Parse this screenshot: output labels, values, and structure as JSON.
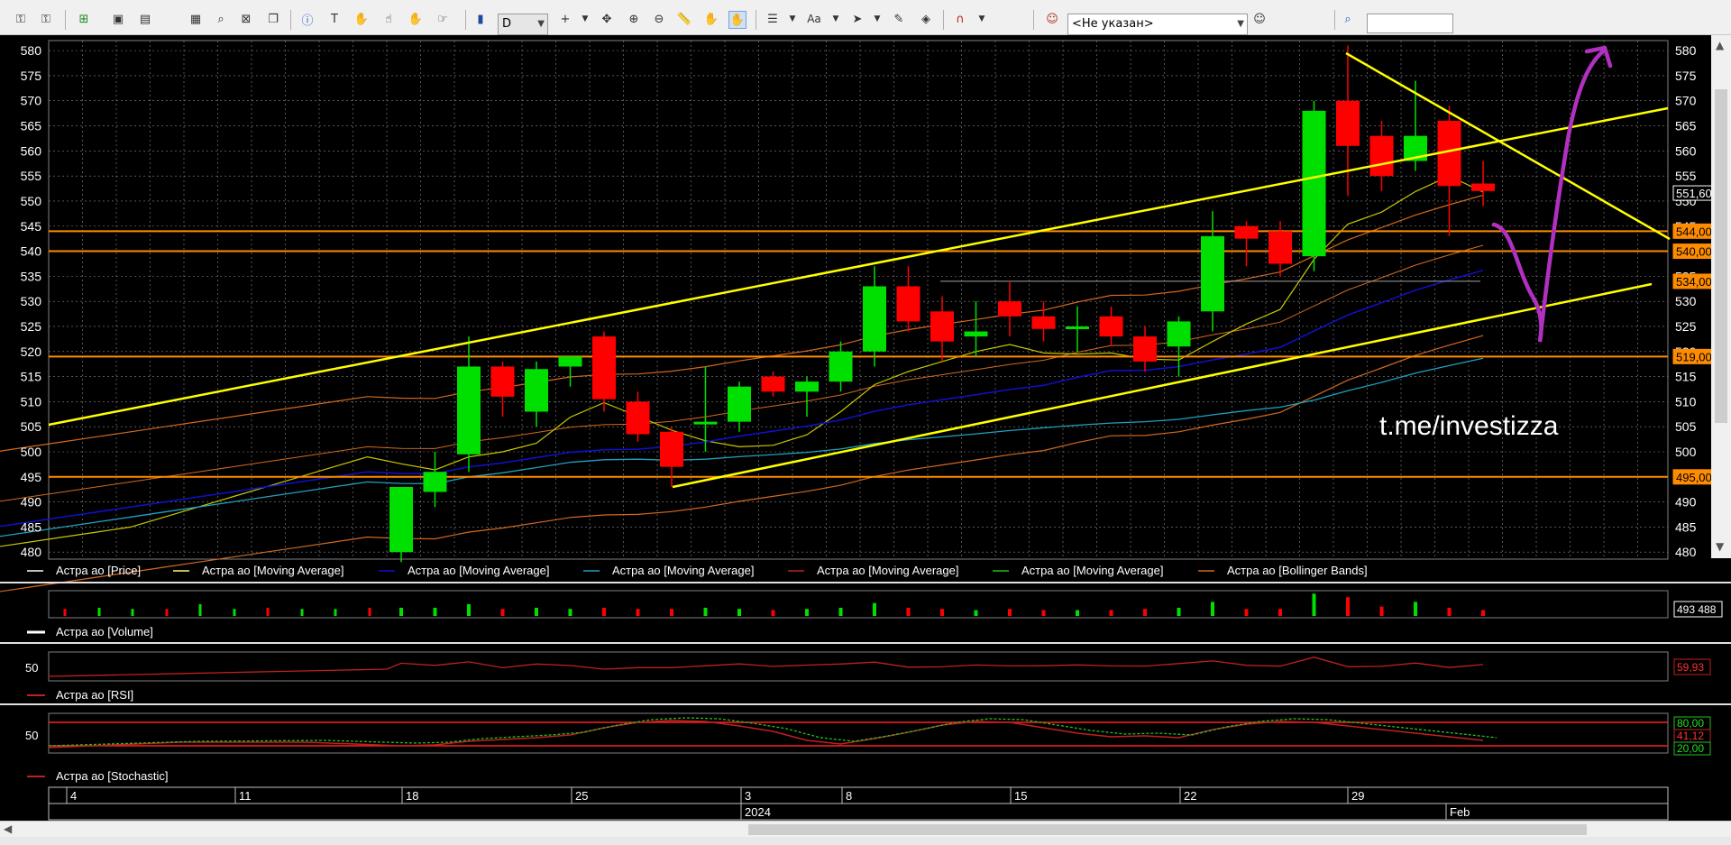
{
  "toolbar": {
    "timeframe": "D",
    "account_select": "<Не указан>",
    "search_value": ""
  },
  "instrument": "Астра ао",
  "watermark": "t.me/investizza",
  "colors": {
    "bull": "#00e000",
    "bear": "#ff0000",
    "trend": "#ffff00",
    "level": "#ff8c00",
    "ma_yellow": "#c8c800",
    "ma_blue": "#1010d0",
    "ma_cyan": "#20a0c0",
    "ma_red": "#c02020",
    "bollinger": "#d2691e",
    "annotation": "#b030c0"
  },
  "price_panel": {
    "y_ticks": [
      480,
      485,
      490,
      495,
      500,
      505,
      510,
      515,
      520,
      525,
      530,
      535,
      540,
      545,
      550,
      555,
      560,
      565,
      570,
      575,
      580
    ],
    "ylim": [
      479.5,
      582
    ],
    "badges": [
      {
        "value": 551.6,
        "label": "551,60",
        "color": "#ffffff",
        "bg": "#000000"
      },
      {
        "value": 544,
        "label": "544,00",
        "color": "#000000",
        "bg": "#ff8c00"
      },
      {
        "value": 540,
        "label": "540,00",
        "color": "#000000",
        "bg": "#ff8c00"
      },
      {
        "value": 534,
        "label": "534,00",
        "color": "#000000",
        "bg": "#ff8c00"
      },
      {
        "value": 519,
        "label": "519,00",
        "color": "#000000",
        "bg": "#ff8c00"
      },
      {
        "value": 495,
        "label": "495,00",
        "color": "#000000",
        "bg": "#ff8c00"
      }
    ],
    "levels": [
      544,
      540,
      519,
      495
    ]
  },
  "legend": [
    {
      "label": "Астра ао [Price]",
      "color": "#ffffff"
    },
    {
      "label": "Астра ао [Moving Average]",
      "color": "#ffff66"
    },
    {
      "label": "Астра ао [Moving Average]",
      "color": "#1010d0"
    },
    {
      "label": "Астра ао [Moving Average]",
      "color": "#20a0c0"
    },
    {
      "label": "Астра ао [Moving Average]",
      "color": "#c02020"
    },
    {
      "label": "Астра ао [Moving Average]",
      "color": "#20c020"
    },
    {
      "label": "Астра ао [Bollinger Bands]",
      "color": "#d2691e"
    }
  ],
  "volume_panel": {
    "label": "Астра ао [Volume]",
    "badge": "493 488"
  },
  "rsi_panel": {
    "label": "Астра ао [RSI]",
    "tick": "50",
    "badge": "59,93",
    "value": 59.93
  },
  "stoch_panel": {
    "label": "Астра ао [Stochastic]",
    "tick": "50",
    "badges": [
      "80,00",
      "41,12",
      "20,00"
    ],
    "value": 41.12
  },
  "x_axis": {
    "day_labels": [
      "4",
      "11",
      "18",
      "25",
      "3",
      "8",
      "15",
      "22",
      "29"
    ],
    "period_labels": [
      "2024",
      "Feb"
    ]
  },
  "chart_data": {
    "type": "candlestick",
    "ylim": [
      479.5,
      582
    ],
    "candles": [
      {
        "o": 480,
        "h": 493,
        "l": 478,
        "c": 493
      },
      {
        "o": 492,
        "h": 500,
        "l": 489,
        "c": 496
      },
      {
        "o": 499.5,
        "h": 523,
        "l": 496,
        "c": 517
      },
      {
        "o": 517,
        "h": 518,
        "l": 507,
        "c": 511
      },
      {
        "o": 508,
        "h": 518,
        "l": 505,
        "c": 516.5
      },
      {
        "o": 517,
        "h": 519,
        "l": 513,
        "c": 519
      },
      {
        "o": 523,
        "h": 524,
        "l": 508,
        "c": 510.5
      },
      {
        "o": 510,
        "h": 512,
        "l": 502,
        "c": 503.5
      },
      {
        "o": 504,
        "h": 505,
        "l": 493,
        "c": 497
      },
      {
        "o": 506,
        "h": 517,
        "l": 500,
        "c": 506
      },
      {
        "o": 506,
        "h": 514,
        "l": 504,
        "c": 513
      },
      {
        "o": 515,
        "h": 516,
        "l": 511,
        "c": 512
      },
      {
        "o": 512,
        "h": 515,
        "l": 507,
        "c": 514
      },
      {
        "o": 514,
        "h": 522,
        "l": 512,
        "c": 520
      },
      {
        "o": 520,
        "h": 537,
        "l": 517,
        "c": 533
      },
      {
        "o": 533,
        "h": 537,
        "l": 524,
        "c": 526
      },
      {
        "o": 528,
        "h": 531,
        "l": 518,
        "c": 522
      },
      {
        "o": 523,
        "h": 530,
        "l": 519,
        "c": 524
      },
      {
        "o": 530,
        "h": 534,
        "l": 523,
        "c": 527
      },
      {
        "o": 527,
        "h": 530,
        "l": 522,
        "c": 524.5
      },
      {
        "o": 524.5,
        "h": 529,
        "l": 520,
        "c": 525
      },
      {
        "o": 527,
        "h": 529,
        "l": 521,
        "c": 523
      },
      {
        "o": 523,
        "h": 525,
        "l": 516,
        "c": 518
      },
      {
        "o": 521,
        "h": 527,
        "l": 515,
        "c": 526
      },
      {
        "o": 528,
        "h": 548,
        "l": 524,
        "c": 543
      },
      {
        "o": 545,
        "h": 546,
        "l": 537,
        "c": 542.5
      },
      {
        "o": 544,
        "h": 546,
        "l": 535,
        "c": 537.5
      },
      {
        "o": 539,
        "h": 570,
        "l": 536,
        "c": 568
      },
      {
        "o": 570,
        "h": 581,
        "l": 551,
        "c": 561
      },
      {
        "o": 563,
        "h": 566,
        "l": 552,
        "c": 555
      },
      {
        "o": 558,
        "h": 574,
        "l": 556,
        "c": 563
      },
      {
        "o": 566,
        "h": 569,
        "l": 543,
        "c": 553
      },
      {
        "o": 553.5,
        "h": 558,
        "l": 549,
        "c": 552
      }
    ],
    "volumes": [
      {
        "v": 0.35,
        "up": true
      },
      {
        "v": 0.35,
        "up": true
      },
      {
        "v": 0.5,
        "up": true
      },
      {
        "v": 0.3,
        "up": false
      },
      {
        "v": 0.35,
        "up": true
      },
      {
        "v": 0.3,
        "up": true
      },
      {
        "v": 0.35,
        "up": false
      },
      {
        "v": 0.3,
        "up": false
      },
      {
        "v": 0.3,
        "up": false
      },
      {
        "v": 0.35,
        "up": true
      },
      {
        "v": 0.3,
        "up": true
      },
      {
        "v": 0.25,
        "up": false
      },
      {
        "v": 0.3,
        "up": true
      },
      {
        "v": 0.35,
        "up": true
      },
      {
        "v": 0.55,
        "up": true
      },
      {
        "v": 0.35,
        "up": false
      },
      {
        "v": 0.3,
        "up": false
      },
      {
        "v": 0.25,
        "up": true
      },
      {
        "v": 0.3,
        "up": false
      },
      {
        "v": 0.25,
        "up": false
      },
      {
        "v": 0.25,
        "up": true
      },
      {
        "v": 0.25,
        "up": false
      },
      {
        "v": 0.3,
        "up": false
      },
      {
        "v": 0.35,
        "up": true
      },
      {
        "v": 0.6,
        "up": true
      },
      {
        "v": 0.3,
        "up": false
      },
      {
        "v": 0.3,
        "up": false
      },
      {
        "v": 0.95,
        "up": true
      },
      {
        "v": 0.8,
        "up": false
      },
      {
        "v": 0.4,
        "up": false
      },
      {
        "v": 0.6,
        "up": true
      },
      {
        "v": 0.35,
        "up": false
      },
      {
        "v": 0.25,
        "up": false
      }
    ]
  }
}
